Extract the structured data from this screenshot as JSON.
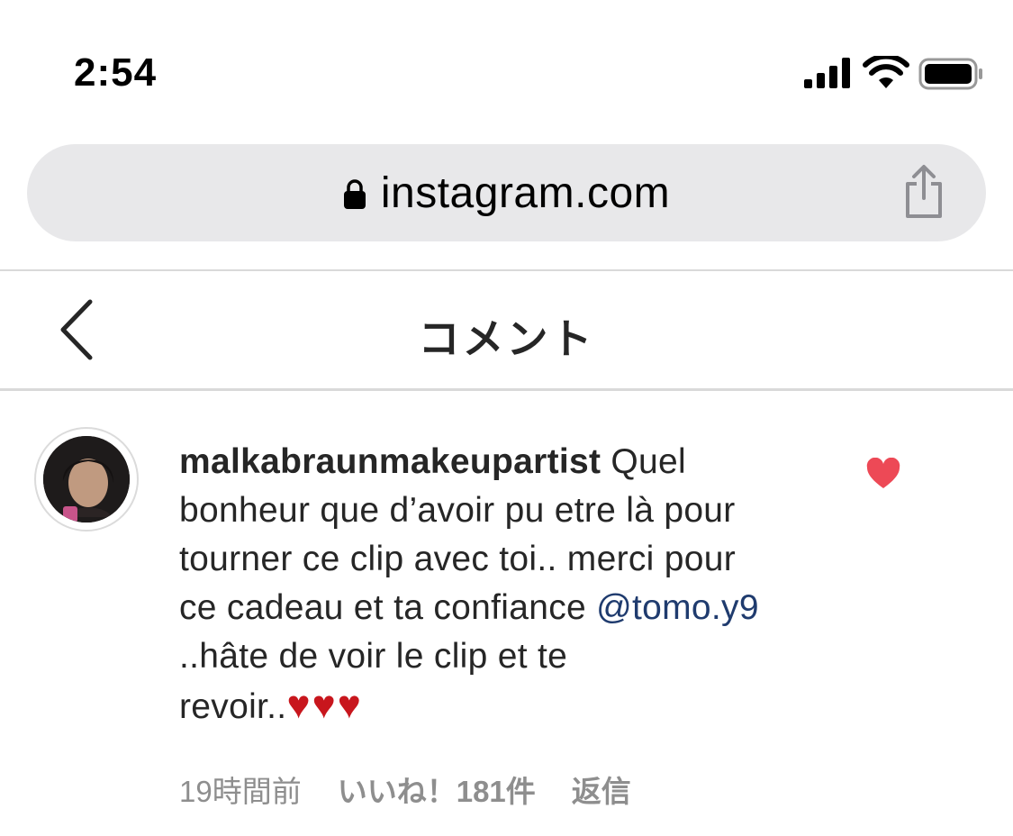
{
  "status_bar": {
    "time": "2:54"
  },
  "browser": {
    "url": "instagram.com"
  },
  "header": {
    "title": "コメント"
  },
  "comment": {
    "username": "malkabraunmakeupartist",
    "text_lines": [
      " Quel",
      "bonheur que d’avoir pu etre là pour",
      "tourner ce clip avec toi.. merci pour",
      "ce cadeau et ta confiance "
    ],
    "mention": "@tomo.y9",
    "text_after_lines": [
      "..hâte de voir le clip et te",
      "revoir.."
    ],
    "emoji": "♥♥♥",
    "time_ago": "19時間前",
    "likes": "いいね！181件",
    "reply": "返信"
  },
  "colors": {
    "heart": "#ed4956",
    "mention": "#1f3b6e",
    "meta": "#8e8e8e"
  }
}
